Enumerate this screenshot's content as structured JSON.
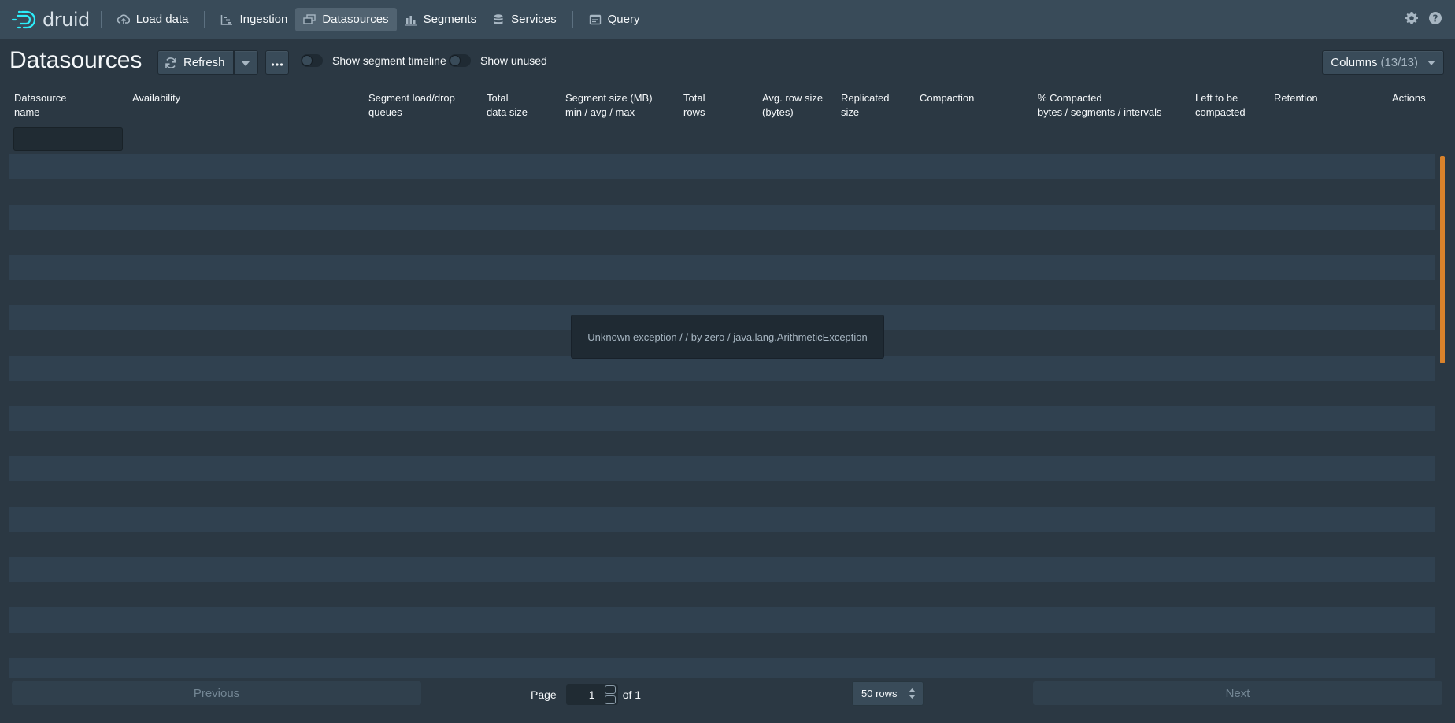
{
  "nav": {
    "logo_text": "druid",
    "items": [
      {
        "label": "Load data"
      },
      {
        "label": "Ingestion"
      },
      {
        "label": "Datasources"
      },
      {
        "label": "Segments"
      },
      {
        "label": "Services"
      },
      {
        "label": "Query"
      }
    ]
  },
  "header": {
    "title": "Datasources",
    "refresh_label": "Refresh",
    "toggle_timeline_label": "Show segment timeline",
    "toggle_unused_label": "Show unused",
    "columns_label": "Columns",
    "columns_count": "(13/13)"
  },
  "table": {
    "columns": [
      {
        "line1": "Datasource",
        "line2": "name"
      },
      {
        "line1": "Availability",
        "line2": ""
      },
      {
        "line1": "Segment load/drop",
        "line2": "queues"
      },
      {
        "line1": "Total",
        "line2": "data size"
      },
      {
        "line1": "Segment size (MB)",
        "line2": "min / avg / max"
      },
      {
        "line1": "Total",
        "line2": "rows"
      },
      {
        "line1": "Avg. row size",
        "line2": "(bytes)"
      },
      {
        "line1": "Replicated",
        "line2": "size"
      },
      {
        "line1": "Compaction",
        "line2": ""
      },
      {
        "line1": "% Compacted",
        "line2": "bytes / segments / intervals"
      },
      {
        "line1": "Left to be",
        "line2": "compacted"
      },
      {
        "line1": "Retention",
        "line2": ""
      },
      {
        "line1": "Actions",
        "line2": ""
      }
    ],
    "error_message": "Unknown exception / / by zero / java.lang.ArithmeticException"
  },
  "pagination": {
    "previous_label": "Previous",
    "next_label": "Next",
    "page_label": "Page",
    "page_value": "1",
    "of_label": "of 1",
    "rows_label": "50 rows"
  },
  "colors": {
    "nav_bg": "#394b59",
    "page_bg": "#2b3843",
    "stripe": "#304150",
    "accent_scroll": "#d9822b"
  }
}
